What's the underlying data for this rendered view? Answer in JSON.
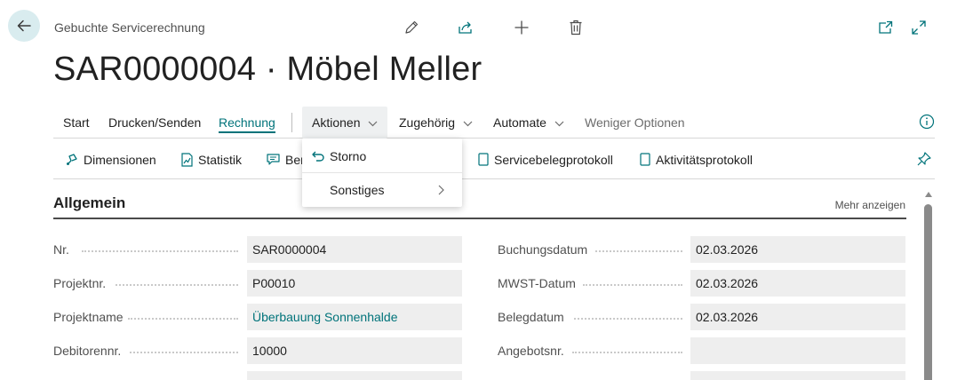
{
  "header": {
    "caption": "Gebuchte Servicerechnung",
    "title": "SAR0000004 · Möbel Meller",
    "icons": [
      "back-arrow-icon",
      "edit-icon",
      "share-icon",
      "add-icon",
      "delete-icon",
      "open-new-window-icon",
      "expand-icon"
    ]
  },
  "tabs": {
    "start": "Start",
    "drucken": "Drucken/Senden",
    "rechnung": "Rechnung",
    "aktionen": "Aktionen",
    "zugehoerig": "Zugehörig",
    "automate": "Automate",
    "weniger": "Weniger Optionen"
  },
  "actions": {
    "dimensionen": "Dimensionen",
    "statistik": "Statistik",
    "bemerkungen": "Ben",
    "servicebeleg": "Servicebelegprotokoll",
    "aktivitaet": "Aktivitätsprotokoll"
  },
  "dropdown": {
    "storno": "Storno",
    "sonstiges": "Sonstiges"
  },
  "section": {
    "title": "Allgemein",
    "more": "Mehr anzeigen"
  },
  "fields_left": [
    {
      "label": "Nr.",
      "value": "SAR0000004"
    },
    {
      "label": "Projektnr.",
      "value": "P00010"
    },
    {
      "label": "Projektname",
      "value": "Überbauung Sonnenhalde"
    },
    {
      "label": "Debitorennr.",
      "value": "10000"
    }
  ],
  "fields_right": [
    {
      "label": "Buchungsdatum",
      "value": "02.03.2026"
    },
    {
      "label": "MWST-Datum",
      "value": "02.03.2026"
    },
    {
      "label": "Belegdatum",
      "value": "02.03.2026"
    },
    {
      "label": "Angebotsnr.",
      "value": ""
    }
  ],
  "colors": {
    "accent": "#00737a",
    "back_button_bg": "#d9ecef",
    "field_bg": "#eeeeee"
  }
}
